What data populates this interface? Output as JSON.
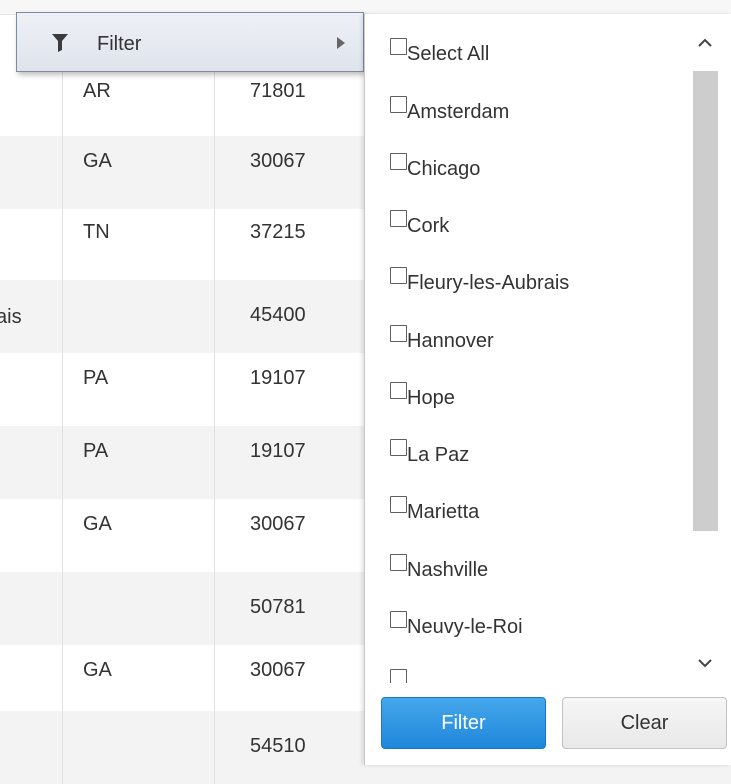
{
  "grid": {
    "rows": [
      {
        "city": "",
        "state": "AR",
        "zip": "71801"
      },
      {
        "city": "",
        "state": "GA",
        "zip": "30067"
      },
      {
        "city": "",
        "state": "TN",
        "zip": "37215"
      },
      {
        "city": "ais",
        "state": "",
        "zip": "45400"
      },
      {
        "city": "",
        "state": "PA",
        "zip": "19107"
      },
      {
        "city": "",
        "state": "PA",
        "zip": "19107"
      },
      {
        "city": "",
        "state": "GA",
        "zip": "30067"
      },
      {
        "city": "",
        "state": "",
        "zip": "50781"
      },
      {
        "city": "",
        "state": "GA",
        "zip": "30067"
      },
      {
        "city": "",
        "state": "",
        "zip": "54510"
      }
    ]
  },
  "context_menu": {
    "icon": "funnel-icon",
    "label": "Filter",
    "submenu_icon": "submenu-arrow-icon"
  },
  "filter_panel": {
    "items": [
      {
        "label": "Select All",
        "checked": false
      },
      {
        "label": "Amsterdam",
        "checked": false
      },
      {
        "label": "Chicago",
        "checked": false
      },
      {
        "label": "Cork",
        "checked": false
      },
      {
        "label": "Fleury-les-Aubrais",
        "checked": false
      },
      {
        "label": "Hannover",
        "checked": false
      },
      {
        "label": "Hope",
        "checked": false
      },
      {
        "label": "La Paz",
        "checked": false
      },
      {
        "label": "Marietta",
        "checked": false
      },
      {
        "label": "Nashville",
        "checked": false
      },
      {
        "label": "Neuvy-le-Roi",
        "checked": false
      },
      {
        "label": "",
        "checked": false
      }
    ],
    "filter_button": "Filter",
    "clear_button": "Clear",
    "colors": {
      "filter_button": "#2f96e3",
      "scroll_thumb": "#cdcdcd"
    }
  }
}
